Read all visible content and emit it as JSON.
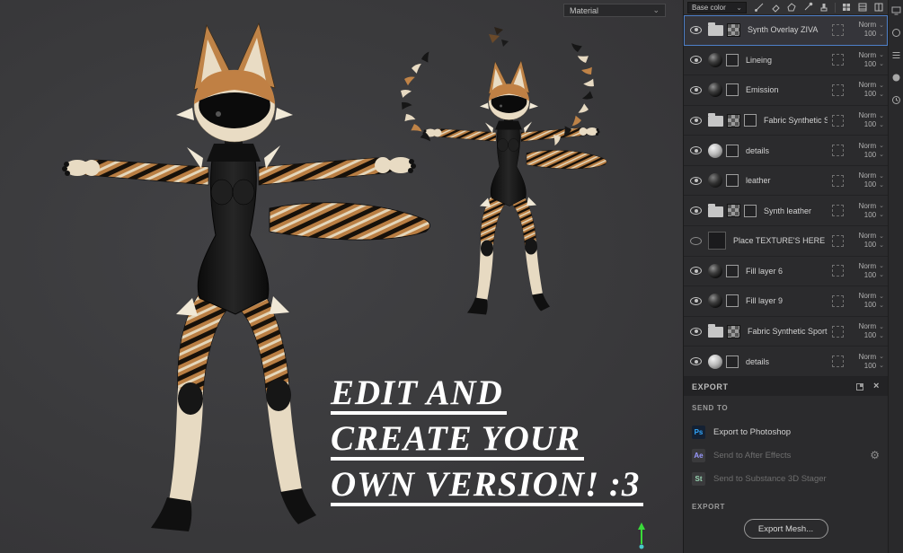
{
  "icons": {
    "chevron_down": "⌄",
    "close": "×",
    "gear": "⚙"
  },
  "colors": {
    "selection_blue": "#4e80c9",
    "viewport_bg": "#3b3b3d",
    "photoshop_badge": "#31a8ff",
    "after_effects_badge": "#9999ff",
    "stager_badge": "#9ad6b4"
  },
  "viewport": {
    "material_dropdown_value": "Material",
    "overlay_lines": [
      "EDIT AND",
      "CREATE YOUR",
      "OWN VERSION! :3"
    ]
  },
  "layers_toolbar": {
    "channel_select_value": "Base color"
  },
  "layers": [
    {
      "name": "Synth Overlay ZIVA",
      "blend": "Norm",
      "opacity": "100",
      "icons": [
        "folder",
        "checker"
      ],
      "selected": true,
      "visible": true
    },
    {
      "name": "Lineing",
      "blend": "Norm",
      "opacity": "100",
      "icons": [
        "sphere-black",
        "mask"
      ],
      "selected": false,
      "visible": true
    },
    {
      "name": "Emission",
      "blend": "Norm",
      "opacity": "100",
      "icons": [
        "sphere-black",
        "mask"
      ],
      "selected": false,
      "visible": true
    },
    {
      "name": "Fabric Synthetic S...",
      "blend": "Norm",
      "opacity": "100",
      "icons": [
        "folder",
        "checker",
        "mask"
      ],
      "selected": false,
      "visible": true
    },
    {
      "name": "details",
      "blend": "Norm",
      "opacity": "100",
      "icons": [
        "sphere-gray",
        "mask"
      ],
      "selected": false,
      "visible": true
    },
    {
      "name": "leather",
      "blend": "Norm",
      "opacity": "100",
      "icons": [
        "sphere-leather",
        "mask"
      ],
      "selected": false,
      "visible": true
    },
    {
      "name": "Synth leather",
      "blend": "Norm",
      "opacity": "100",
      "icons": [
        "folder",
        "checker",
        "mask"
      ],
      "selected": false,
      "visible": true
    },
    {
      "name": "Place TEXTURE'S HERE",
      "blend": "Norm",
      "opacity": "100",
      "icons": [
        "bigsquare"
      ],
      "selected": false,
      "visible": false
    },
    {
      "name": "Fill layer 6",
      "blend": "Norm",
      "opacity": "100",
      "icons": [
        "sphere-black",
        "mask"
      ],
      "selected": false,
      "visible": true
    },
    {
      "name": "Fill layer 9",
      "blend": "Norm",
      "opacity": "100",
      "icons": [
        "sphere-black",
        "mask"
      ],
      "selected": false,
      "visible": true
    },
    {
      "name": "Fabric Synthetic Sport...",
      "blend": "Norm",
      "opacity": "100",
      "icons": [
        "folder",
        "checker"
      ],
      "selected": false,
      "visible": true
    },
    {
      "name": "details",
      "blend": "Norm",
      "opacity": "100",
      "icons": [
        "sphere-gray",
        "mask"
      ],
      "selected": false,
      "visible": true
    }
  ],
  "export_panel": {
    "title": "EXPORT",
    "send_to_label": "SEND TO",
    "send_items": [
      {
        "badge": "Ps",
        "badge_color": "#31a8ff",
        "label": "Export to Photoshop",
        "enabled": true,
        "gear": false
      },
      {
        "badge": "Ae",
        "badge_color": "#9999ff",
        "label": "Send to After Effects",
        "enabled": false,
        "gear": true
      },
      {
        "badge": "St",
        "badge_color": "#9ad6b4",
        "label": "Send to Substance 3D Stager",
        "enabled": false,
        "gear": false
      }
    ],
    "export_label": "EXPORT",
    "export_mesh_button": "Export Mesh..."
  }
}
